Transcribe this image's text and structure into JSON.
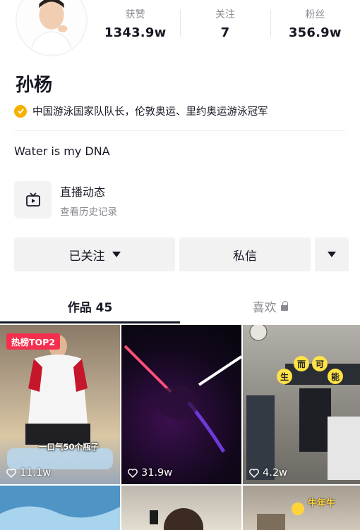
{
  "profile": {
    "name": "孙杨",
    "verification": "中国游泳国家队队长，伦敦奥运、里约奥运游泳冠军",
    "bio": "Water is my DNA",
    "verify_color": "#f5b100"
  },
  "stats": [
    {
      "label": "获赞",
      "value": "1343.9w"
    },
    {
      "label": "关注",
      "value": "7"
    },
    {
      "label": "粉丝",
      "value": "356.9w"
    }
  ],
  "live": {
    "icon": "tv-icon",
    "title": "直播动态",
    "subtitle": "查看历史记录"
  },
  "actions": {
    "follow_label": "已关注",
    "message_label": "私信"
  },
  "tabs": {
    "works_label": "作品 45",
    "likes_label": "喜欢"
  },
  "videos": [
    {
      "tag": "热榜TOP2",
      "caption": "一口气50个瓶子",
      "likes": "11.1w"
    },
    {
      "likes": "31.9w"
    },
    {
      "likes": "4.2w",
      "stickers": [
        "生",
        "而",
        "可",
        "能"
      ]
    },
    {},
    {},
    {
      "sticker": "牛年牛"
    }
  ],
  "colors": {
    "text_primary": "#161823",
    "text_secondary": "#8a8b91",
    "hot_tag": "#f5304f",
    "button_bg": "#f2f2f3"
  }
}
